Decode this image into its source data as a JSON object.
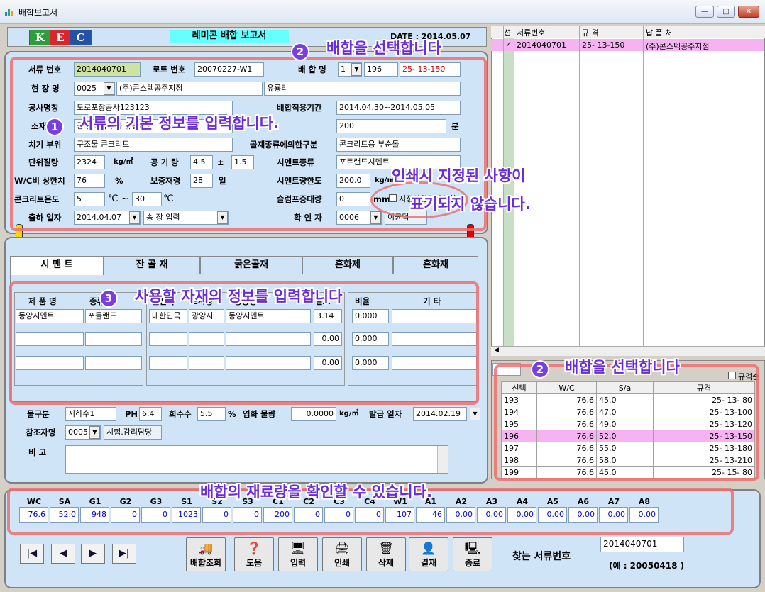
{
  "window": {
    "title": "배합보고서",
    "min": "—",
    "max": "□",
    "close": "✕"
  },
  "header": {
    "logo": [
      "K",
      "E",
      "C"
    ],
    "report_title": "레미콘 배합 보고서",
    "date_label": "DATE : 2014.05.07"
  },
  "form": {
    "doc_no_label": "서류 번호",
    "doc_no": "2014040701",
    "lot_label": "로트 번호",
    "lot": "20070227-W1",
    "mix_name_label": "배 합 명",
    "mix_1": "1",
    "mix_2": "196",
    "mix_spec": "25- 13-150",
    "site_label": "현 장 명",
    "site_code": "0025",
    "site_name": "(주)콘스텍공주지점",
    "site_extra": "유룡리",
    "project_label": "공사명칭",
    "project": "도로포장공사123123",
    "apply_label": "배합적용기간",
    "apply_period": "2014.04.30~2014.05.05",
    "loc_label": "소재지",
    "loc": "공주시 유구읍 유룡리1",
    "loc_right": "200",
    "min_unit": "분",
    "pour_label": "치기 부위",
    "pour": "구조물 콘크리트",
    "aggtype_label": "골재종류에의한구분",
    "aggtype": "콘크리트용 부순돌",
    "unitmass_label": "단위질량",
    "unitmass": "2324",
    "unitmass_unit": "kg/㎥",
    "air_label": "공 기 량",
    "air": "4.5",
    "pm": "±",
    "air_tol": "1.5",
    "cement_label": "시멘트종류",
    "cement": "포트랜드시멘트",
    "wc_label": "W/C비 상한치",
    "wc": "76",
    "pct": "%",
    "strength_label": "보증재령",
    "strength": "28",
    "day": "일",
    "cemlimit_label": "시멘트량한도",
    "cemlimit": "200.0",
    "cemlimit_unit": "kg/m",
    "temp_label": "콘크리트온도",
    "temp_from": "5",
    "temp_unit1": "℃ ~",
    "temp_to": "30",
    "temp_unit2": "℃",
    "slump_label": "슬럼프증대량",
    "slump": "0",
    "slump_unit": "mm",
    "print_chk": "지정사항인쇄안함",
    "ship_label": "출하 일자",
    "ship_date": "2014.04.07",
    "ship_mode": "송 장 입력",
    "confirm_label": "확 인 자",
    "confirm_code": "0006",
    "confirm_name": "이균덕"
  },
  "tabs": [
    "시 멘 트",
    "잔 골 재",
    "굵은골재",
    "혼화제",
    "혼화재"
  ],
  "cement_tab": {
    "headers": [
      "제 품 명",
      "종류",
      "원산지",
      "도시명",
      "공장명",
      "밀도",
      "비율",
      "기    타"
    ],
    "rows": [
      [
        "동양시멘트",
        "포틀랜드",
        "대한민국",
        "광양시",
        "동양시멘트",
        "3.14",
        "0.000",
        ""
      ],
      [
        "",
        "",
        "",
        "",
        "",
        "0.00",
        "0.000",
        ""
      ],
      [
        "",
        "",
        "",
        "",
        "",
        "0.00",
        "0.000",
        ""
      ]
    ]
  },
  "water": {
    "type_label": "물구분",
    "type": "지하수1",
    "ph_label": "PH",
    "ph": "6.4",
    "recover_label": "회수수",
    "recover": "5.5",
    "pct": "%",
    "salt_label": "염화 물량",
    "salt": "0.0000",
    "salt_unit": "kg/㎥",
    "issue_label": "발급 일자",
    "issue_date": "2014.02.19"
  },
  "ref": {
    "label": "참조자명",
    "code": "0005",
    "name": "시험.감리담당"
  },
  "remark_label": "비    고",
  "docs": {
    "headers": [
      "선",
      "서류번호",
      "규 격",
      "납 품 처"
    ],
    "rows": [
      {
        "chk": "✓",
        "no": "2014040701",
        "spec": "25- 13-150",
        "dest": "(주)콘스텍공주지점"
      }
    ]
  },
  "mixlist": {
    "filter_label": "규격순",
    "headers": [
      "선택",
      "W/C",
      "S/a",
      "규격"
    ],
    "rows": [
      [
        "193",
        "76.6",
        "45.0",
        "25- 13- 80"
      ],
      [
        "194",
        "76.6",
        "47.0",
        "25- 13-100"
      ],
      [
        "195",
        "76.6",
        "49.0",
        "25- 13-120"
      ],
      [
        "196",
        "76.6",
        "52.0",
        "25- 13-150"
      ],
      [
        "197",
        "76.6",
        "55.0",
        "25- 13-180"
      ],
      [
        "198",
        "76.6",
        "58.0",
        "25- 13-210"
      ],
      [
        "199",
        "76.6",
        "45.0",
        "25- 15- 80"
      ]
    ]
  },
  "materials": {
    "headers": [
      "WC",
      "SA",
      "G1",
      "G2",
      "G3",
      "S1",
      "S2",
      "S3",
      "C1",
      "C2",
      "C3",
      "C4",
      "W1",
      "A1",
      "A2",
      "A3",
      "A4",
      "A5",
      "A6",
      "A7",
      "A8"
    ],
    "values": [
      "76.6",
      "52.0",
      "948",
      "0",
      "0",
      "1023",
      "0",
      "0",
      "200",
      "0",
      "0",
      "0",
      "107",
      "46",
      "0.00",
      "0.00",
      "0.00",
      "0.00",
      "0.00",
      "0.00",
      "0.00"
    ]
  },
  "buttons": [
    "배합조회",
    "도움",
    "입력",
    "인쇄",
    "삭제",
    "결재",
    "종료"
  ],
  "nav": [
    "|◀",
    "◀",
    "▶",
    "▶|"
  ],
  "search": {
    "label": "찾는 서류번호",
    "value": "2014040701",
    "example": "(예 : 20050418 )"
  },
  "annotations": {
    "a1": "서류의 기본 정보를 입력합니다.",
    "a2": "배합을 선택합니다",
    "a3": "사용할 자재의 정보를 입력합니다",
    "a4": "인쇄시 지정된 사항이",
    "a4b": "표기되지 않습니다.",
    "a5": "배합의 재료량을 확인할 수 있습니다.",
    "n1": "1",
    "n2": "2",
    "n3": "3"
  }
}
